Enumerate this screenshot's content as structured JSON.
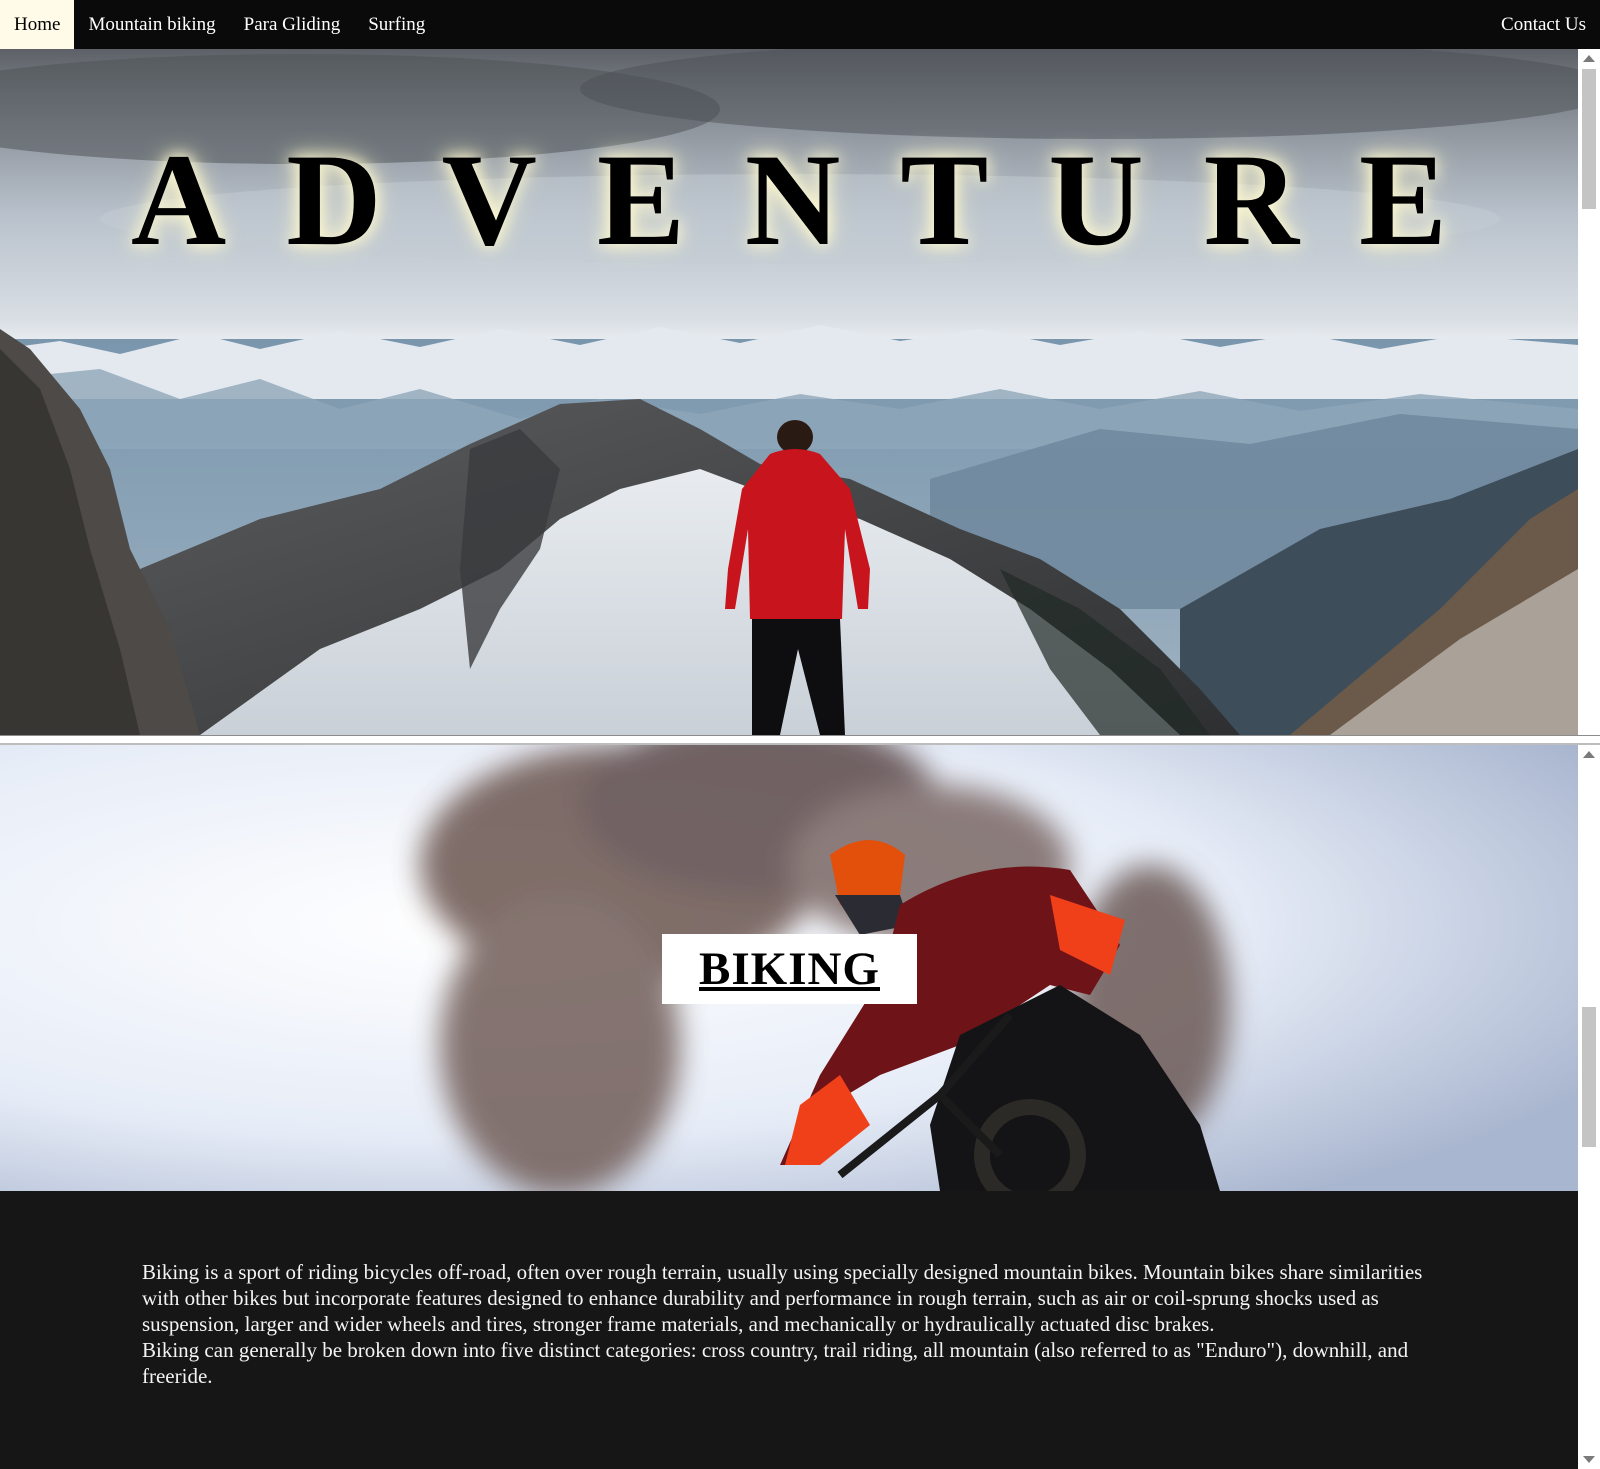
{
  "nav": {
    "items": [
      {
        "label": "Home",
        "active": true
      },
      {
        "label": "Mountain biking",
        "active": false
      },
      {
        "label": "Para Gliding",
        "active": false
      },
      {
        "label": "Surfing",
        "active": false
      }
    ],
    "contact_label": "Contact Us"
  },
  "hero": {
    "title": "ADVENTURE",
    "image_icon": "mountain-landscape-photo"
  },
  "biking": {
    "heading": "BIKING",
    "image_icon": "mountain-biker-photo",
    "paragraphs": [
      "Biking is a sport of riding bicycles off-road, often over rough terrain, usually using specially designed mountain bikes. Mountain bikes share similarities with other bikes but incorporate features designed to enhance durability and performance in rough terrain, such as air or coil-sprung shocks used as suspension, larger and wider wheels and tires, stronger frame materials, and mechanically or hydraulically actuated disc brakes.",
      "Biking can generally be broken down into five distinct categories: cross country, trail riding, all mountain (also referred to as \"Enduro\"), downhill, and freeride."
    ]
  },
  "colors": {
    "navbar_bg": "#0a0a0a",
    "active_tab_bg": "#fffbe8",
    "text_panel_bg": "#161616",
    "jacket_red": "#c8141c"
  }
}
